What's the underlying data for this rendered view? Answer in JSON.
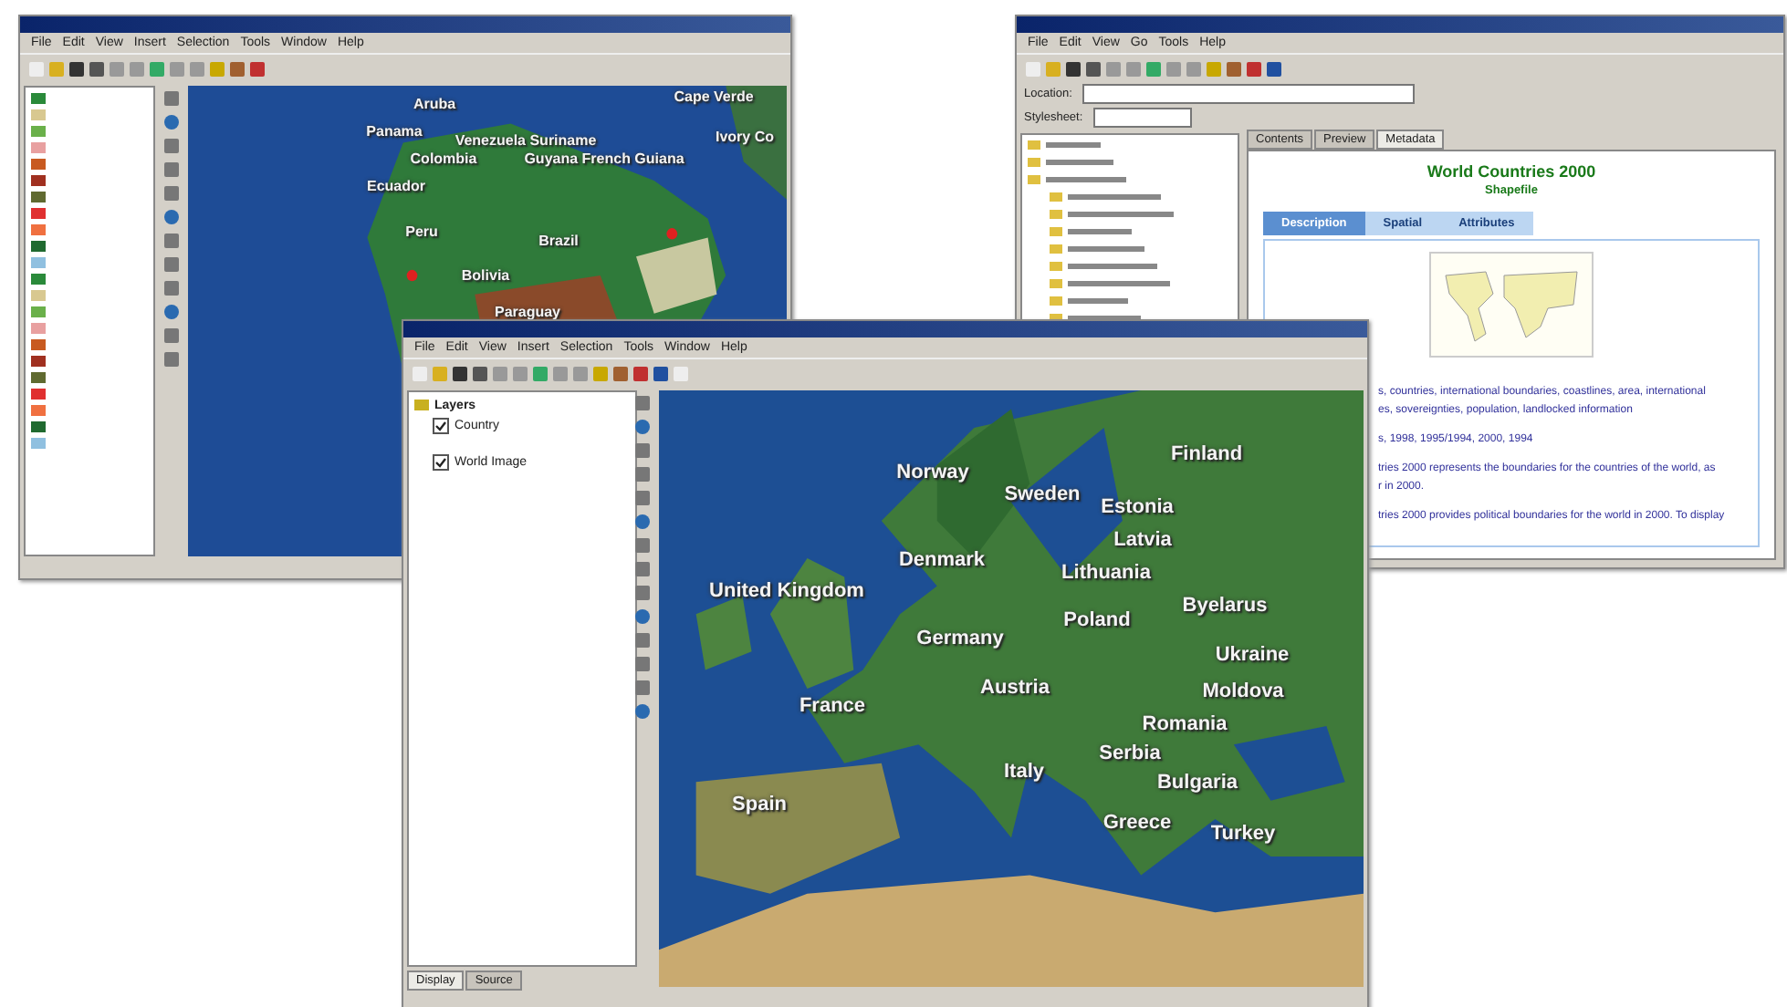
{
  "windows": [
    {
      "kind": "arcmap",
      "menu": [
        "File",
        "Edit",
        "View",
        "Insert",
        "Selection",
        "Tools",
        "Window",
        "Help"
      ],
      "map_labels": [
        "Cape Verde",
        "Aruba",
        "Panama",
        "Venezuela Suriname",
        "Colombia",
        "Guyana French Guiana",
        "Ivory Co",
        "Ecuador",
        "Peru",
        "Brazil",
        "Bolivia",
        "Paraguay"
      ]
    },
    {
      "kind": "catalog",
      "menu": [
        "File",
        "Edit",
        "View",
        "Go",
        "Tools",
        "Help"
      ],
      "location_label": "Location:",
      "stylesheet_label": "Stylesheet:",
      "view_tabs": [
        {
          "label": "Contents",
          "selected": false
        },
        {
          "label": "Preview",
          "selected": false
        },
        {
          "label": "Metadata",
          "selected": true
        }
      ],
      "title": "World Countries 2000",
      "subtitle": "Shapefile",
      "meta_tabs": [
        {
          "label": "Description",
          "selected": true
        },
        {
          "label": "Spatial",
          "selected": false
        },
        {
          "label": "Attributes",
          "selected": false
        }
      ],
      "description": [
        "s, countries, international boundaries, coastlines, area, international",
        "es, sovereignties, population, landlocked information",
        "s, 1998, 1995/1994, 2000, 1994",
        "tries 2000 represents the boundaries for the countries of the world, as",
        "r in 2000.",
        "tries 2000 provides political boundaries for the world in 2000. To display"
      ]
    },
    {
      "kind": "arcmap",
      "menu": [
        "File",
        "Edit",
        "View",
        "Insert",
        "Selection",
        "Tools",
        "Window",
        "Help"
      ],
      "toc_root": "Layers",
      "layers": [
        {
          "name": "Country",
          "checked": true
        },
        {
          "name": "World Image",
          "checked": true
        }
      ],
      "bottom_tabs": [
        {
          "label": "Display",
          "selected": true
        },
        {
          "label": "Source",
          "selected": false
        }
      ],
      "map_labels": [
        "Norway",
        "Sweden",
        "Finland",
        "Estonia",
        "Latvia",
        "Denmark",
        "Lithuania",
        "United Kingdom",
        "Poland",
        "Byelarus",
        "Germany",
        "Ukraine",
        "Austria",
        "Moldova",
        "France",
        "Romania",
        "Serbia",
        "Italy",
        "Bulgaria",
        "Spain",
        "Greece",
        "Turkey"
      ]
    }
  ]
}
